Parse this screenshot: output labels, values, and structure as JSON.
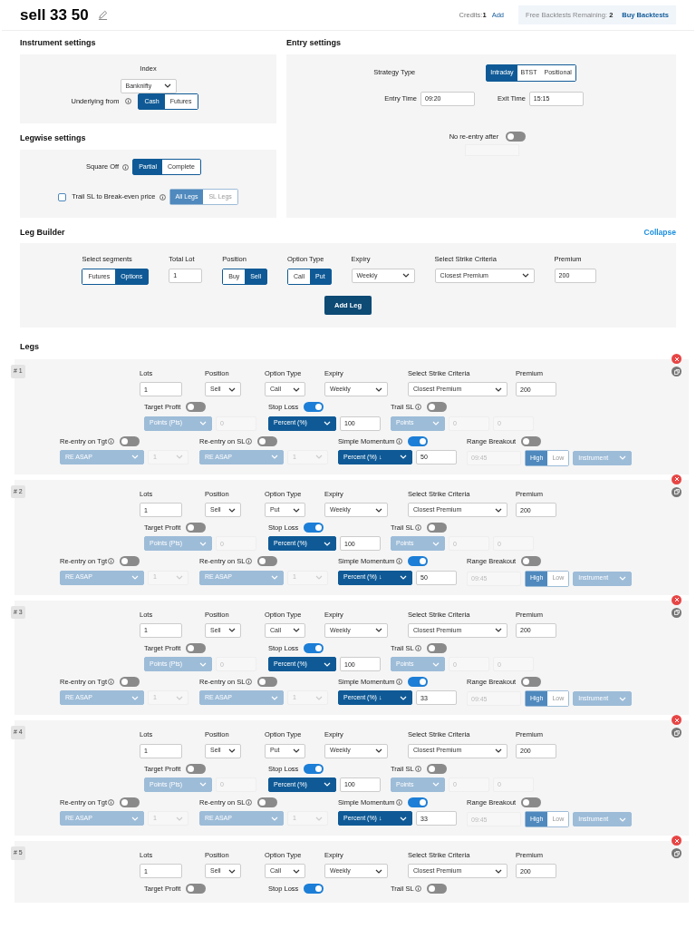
{
  "header": {
    "title": "sell 33 50",
    "credits_label": "Credits:",
    "credits_value": "1",
    "add_link": "Add",
    "backtests_label": "Free Backtests Remaining:",
    "backtests_value": "2",
    "buy_link": "Buy Backtests"
  },
  "instrument_settings": {
    "title": "Instrument settings",
    "index_label": "Index",
    "index_value": "Banknifty",
    "underlying_label": "Underlying from",
    "underlying_options": [
      {
        "label": "Cash",
        "selected": true
      },
      {
        "label": "Futures",
        "selected": false
      }
    ]
  },
  "legwise_settings": {
    "title": "Legwise settings",
    "square_off_label": "Square Off",
    "square_off_options": [
      {
        "label": "Partial",
        "selected": true
      },
      {
        "label": "Complete",
        "selected": false
      }
    ],
    "trail_label": "Trail SL to Break-even price",
    "trail_checked": false,
    "trail_options_disabled": true,
    "trail_options": [
      {
        "label": "All Legs",
        "selected": true
      },
      {
        "label": "SL Legs",
        "selected": false
      }
    ]
  },
  "entry_settings": {
    "title": "Entry settings",
    "strategy_label": "Strategy Type",
    "strategy_options": [
      {
        "label": "Intraday",
        "selected": true
      },
      {
        "label": "BTST",
        "selected": false
      },
      {
        "label": "Positional",
        "selected": false
      }
    ],
    "entry_time_label": "Entry Time",
    "entry_time": "09:20",
    "exit_time_label": "Exit Time",
    "exit_time": "15:15",
    "no_reentry_label": "No re-entry after",
    "no_reentry_on": false
  },
  "leg_builder": {
    "title": "Leg Builder",
    "collapse_link": "Collapse",
    "add_button": "Add Leg",
    "fields": [
      {
        "label": "Select segments",
        "kind": "segmented",
        "options": [
          {
            "label": "Futures",
            "selected": false
          },
          {
            "label": "Options",
            "selected": true
          }
        ]
      },
      {
        "label": "Total Lot",
        "kind": "input",
        "value": "1"
      },
      {
        "label": "Position",
        "kind": "segmented",
        "options": [
          {
            "label": "Buy",
            "selected": false
          },
          {
            "label": "Sell",
            "selected": true
          }
        ]
      },
      {
        "label": "Option Type",
        "kind": "segmented",
        "options": [
          {
            "label": "Call",
            "selected": false
          },
          {
            "label": "Put",
            "selected": true
          }
        ]
      },
      {
        "label": "Expiry",
        "kind": "select",
        "value": "Weekly"
      },
      {
        "label": "Select Strike Criteria",
        "kind": "select",
        "value": "Closest Premium"
      },
      {
        "label": "Premium",
        "kind": "input",
        "value": "200"
      }
    ]
  },
  "legs_title": "Legs",
  "legs": [
    {
      "number": "# 1",
      "fields": [
        {
          "label": "Lots",
          "kind": "input",
          "value": "1"
        },
        {
          "label": "Position",
          "kind": "select",
          "value": "Sell"
        },
        {
          "label": "Option Type",
          "kind": "select",
          "value": "Call"
        },
        {
          "label": "Expiry",
          "kind": "select",
          "value": "Weekly"
        },
        {
          "label": "Select Strike Criteria",
          "kind": "select",
          "value": "Closest Premium"
        },
        {
          "label": "Premium",
          "kind": "input",
          "value": "200"
        }
      ],
      "rows": [
        [
          {
            "label": "Target Profit",
            "info": false,
            "on": false,
            "controls": [
              {
                "kind": "select",
                "value": "Points (Pts)",
                "disabled": true
              },
              {
                "kind": "input",
                "value": "0",
                "disabled": true
              }
            ]
          },
          {
            "label": "Stop Loss",
            "info": false,
            "on": true,
            "controls": [
              {
                "kind": "select",
                "value": "Percent (%)",
                "disabled": false
              },
              {
                "kind": "input",
                "value": "100",
                "disabled": false
              }
            ]
          },
          {
            "label": "Trail SL",
            "info": true,
            "on": false,
            "controls": [
              {
                "kind": "select",
                "value": "Points",
                "disabled": true
              },
              {
                "kind": "input",
                "value": "0",
                "disabled": true
              },
              {
                "kind": "input",
                "value": "0",
                "disabled": true
              }
            ]
          }
        ],
        [
          {
            "label": "Re-entry on Tgt",
            "info": true,
            "on": false,
            "controls": [
              {
                "kind": "select",
                "value": "RE ASAP",
                "disabled": true
              },
              {
                "kind": "select",
                "value": "1",
                "disabled": true
              }
            ]
          },
          {
            "label": "Re-entry on SL",
            "info": true,
            "on": false,
            "controls": [
              {
                "kind": "select",
                "value": "RE ASAP",
                "disabled": true
              },
              {
                "kind": "select",
                "value": "1",
                "disabled": true
              }
            ]
          },
          {
            "label": "Simple Momentum",
            "info": true,
            "on": true,
            "controls": [
              {
                "kind": "select",
                "value": "Percent (%) ↓",
                "disabled": false
              },
              {
                "kind": "input",
                "value": "50",
                "disabled": false
              }
            ]
          },
          {
            "label": "Range Breakout",
            "info": false,
            "on": false,
            "controls": [
              {
                "kind": "input",
                "value": "09:45",
                "disabled": true
              },
              {
                "kind": "segmented",
                "disabled": true,
                "options": [
                  {
                    "label": "High",
                    "selected": true
                  },
                  {
                    "label": "Low",
                    "selected": false
                  }
                ]
              },
              {
                "kind": "select",
                "value": "Instrument",
                "disabled": true
              }
            ]
          }
        ]
      ]
    },
    {
      "number": "# 2",
      "fields": [
        {
          "label": "Lots",
          "kind": "input",
          "value": "1"
        },
        {
          "label": "Position",
          "kind": "select",
          "value": "Sell"
        },
        {
          "label": "Option Type",
          "kind": "select",
          "value": "Put"
        },
        {
          "label": "Expiry",
          "kind": "select",
          "value": "Weekly"
        },
        {
          "label": "Select Strike Criteria",
          "kind": "select",
          "value": "Closest Premium"
        },
        {
          "label": "Premium",
          "kind": "input",
          "value": "200"
        }
      ],
      "rows": [
        [
          {
            "label": "Target Profit",
            "info": false,
            "on": false,
            "controls": [
              {
                "kind": "select",
                "value": "Points (Pts)",
                "disabled": true
              },
              {
                "kind": "input",
                "value": "0",
                "disabled": true
              }
            ]
          },
          {
            "label": "Stop Loss",
            "info": false,
            "on": true,
            "controls": [
              {
                "kind": "select",
                "value": "Percent (%)",
                "disabled": false
              },
              {
                "kind": "input",
                "value": "100",
                "disabled": false
              }
            ]
          },
          {
            "label": "Trail SL",
            "info": true,
            "on": false,
            "controls": [
              {
                "kind": "select",
                "value": "Points",
                "disabled": true
              },
              {
                "kind": "input",
                "value": "0",
                "disabled": true
              },
              {
                "kind": "input",
                "value": "0",
                "disabled": true
              }
            ]
          }
        ],
        [
          {
            "label": "Re-entry on Tgt",
            "info": true,
            "on": false,
            "controls": [
              {
                "kind": "select",
                "value": "RE ASAP",
                "disabled": true
              },
              {
                "kind": "select",
                "value": "1",
                "disabled": true
              }
            ]
          },
          {
            "label": "Re-entry on SL",
            "info": true,
            "on": false,
            "controls": [
              {
                "kind": "select",
                "value": "RE ASAP",
                "disabled": true
              },
              {
                "kind": "select",
                "value": "1",
                "disabled": true
              }
            ]
          },
          {
            "label": "Simple Momentum",
            "info": true,
            "on": true,
            "controls": [
              {
                "kind": "select",
                "value": "Percent (%) ↓",
                "disabled": false
              },
              {
                "kind": "input",
                "value": "50",
                "disabled": false
              }
            ]
          },
          {
            "label": "Range Breakout",
            "info": false,
            "on": false,
            "controls": [
              {
                "kind": "input",
                "value": "09:45",
                "disabled": true
              },
              {
                "kind": "segmented",
                "disabled": true,
                "options": [
                  {
                    "label": "High",
                    "selected": true
                  },
                  {
                    "label": "Low",
                    "selected": false
                  }
                ]
              },
              {
                "kind": "select",
                "value": "Instrument",
                "disabled": true
              }
            ]
          }
        ]
      ]
    },
    {
      "number": "# 3",
      "fields": [
        {
          "label": "Lots",
          "kind": "input",
          "value": "1"
        },
        {
          "label": "Position",
          "kind": "select",
          "value": "Sell"
        },
        {
          "label": "Option Type",
          "kind": "select",
          "value": "Call"
        },
        {
          "label": "Expiry",
          "kind": "select",
          "value": "Weekly"
        },
        {
          "label": "Select Strike Criteria",
          "kind": "select",
          "value": "Closest Premium"
        },
        {
          "label": "Premium",
          "kind": "input",
          "value": "200"
        }
      ],
      "rows": [
        [
          {
            "label": "Target Profit",
            "info": false,
            "on": false,
            "controls": [
              {
                "kind": "select",
                "value": "Points (Pts)",
                "disabled": true
              },
              {
                "kind": "input",
                "value": "0",
                "disabled": true
              }
            ]
          },
          {
            "label": "Stop Loss",
            "info": false,
            "on": true,
            "controls": [
              {
                "kind": "select",
                "value": "Percent (%)",
                "disabled": false
              },
              {
                "kind": "input",
                "value": "100",
                "disabled": false
              }
            ]
          },
          {
            "label": "Trail SL",
            "info": true,
            "on": false,
            "controls": [
              {
                "kind": "select",
                "value": "Points",
                "disabled": true
              },
              {
                "kind": "input",
                "value": "0",
                "disabled": true
              },
              {
                "kind": "input",
                "value": "0",
                "disabled": true
              }
            ]
          }
        ],
        [
          {
            "label": "Re-entry on Tgt",
            "info": true,
            "on": false,
            "controls": [
              {
                "kind": "select",
                "value": "RE ASAP",
                "disabled": true
              },
              {
                "kind": "select",
                "value": "1",
                "disabled": true
              }
            ]
          },
          {
            "label": "Re-entry on SL",
            "info": true,
            "on": false,
            "controls": [
              {
                "kind": "select",
                "value": "RE ASAP",
                "disabled": true
              },
              {
                "kind": "select",
                "value": "1",
                "disabled": true
              }
            ]
          },
          {
            "label": "Simple Momentum",
            "info": true,
            "on": true,
            "controls": [
              {
                "kind": "select",
                "value": "Percent (%) ↓",
                "disabled": false
              },
              {
                "kind": "input",
                "value": "33",
                "disabled": false
              }
            ]
          },
          {
            "label": "Range Breakout",
            "info": false,
            "on": false,
            "controls": [
              {
                "kind": "input",
                "value": "09:45",
                "disabled": true
              },
              {
                "kind": "segmented",
                "disabled": true,
                "options": [
                  {
                    "label": "High",
                    "selected": true
                  },
                  {
                    "label": "Low",
                    "selected": false
                  }
                ]
              },
              {
                "kind": "select",
                "value": "Instrument",
                "disabled": true
              }
            ]
          }
        ]
      ]
    },
    {
      "number": "# 4",
      "fields": [
        {
          "label": "Lots",
          "kind": "input",
          "value": "1"
        },
        {
          "label": "Position",
          "kind": "select",
          "value": "Sell"
        },
        {
          "label": "Option Type",
          "kind": "select",
          "value": "Put"
        },
        {
          "label": "Expiry",
          "kind": "select",
          "value": "Weekly"
        },
        {
          "label": "Select Strike Criteria",
          "kind": "select",
          "value": "Closest Premium"
        },
        {
          "label": "Premium",
          "kind": "input",
          "value": "200"
        }
      ],
      "rows": [
        [
          {
            "label": "Target Profit",
            "info": false,
            "on": false,
            "controls": [
              {
                "kind": "select",
                "value": "Points (Pts)",
                "disabled": true
              },
              {
                "kind": "input",
                "value": "0",
                "disabled": true
              }
            ]
          },
          {
            "label": "Stop Loss",
            "info": false,
            "on": true,
            "controls": [
              {
                "kind": "select",
                "value": "Percent (%)",
                "disabled": false
              },
              {
                "kind": "input",
                "value": "100",
                "disabled": false
              }
            ]
          },
          {
            "label": "Trail SL",
            "info": true,
            "on": false,
            "controls": [
              {
                "kind": "select",
                "value": "Points",
                "disabled": true
              },
              {
                "kind": "input",
                "value": "0",
                "disabled": true
              },
              {
                "kind": "input",
                "value": "0",
                "disabled": true
              }
            ]
          }
        ],
        [
          {
            "label": "Re-entry on Tgt",
            "info": true,
            "on": false,
            "controls": [
              {
                "kind": "select",
                "value": "RE ASAP",
                "disabled": true
              },
              {
                "kind": "select",
                "value": "1",
                "disabled": true
              }
            ]
          },
          {
            "label": "Re-entry on SL",
            "info": true,
            "on": false,
            "controls": [
              {
                "kind": "select",
                "value": "RE ASAP",
                "disabled": true
              },
              {
                "kind": "select",
                "value": "1",
                "disabled": true
              }
            ]
          },
          {
            "label": "Simple Momentum",
            "info": true,
            "on": true,
            "controls": [
              {
                "kind": "select",
                "value": "Percent (%) ↓",
                "disabled": false
              },
              {
                "kind": "input",
                "value": "33",
                "disabled": false
              }
            ]
          },
          {
            "label": "Range Breakout",
            "info": false,
            "on": false,
            "controls": [
              {
                "kind": "input",
                "value": "09:45",
                "disabled": true
              },
              {
                "kind": "segmented",
                "disabled": true,
                "options": [
                  {
                    "label": "High",
                    "selected": true
                  },
                  {
                    "label": "Low",
                    "selected": false
                  }
                ]
              },
              {
                "kind": "select",
                "value": "Instrument",
                "disabled": true
              }
            ]
          }
        ]
      ]
    },
    {
      "number": "# 5",
      "fields": [
        {
          "label": "Lots",
          "kind": "input",
          "value": "1"
        },
        {
          "label": "Position",
          "kind": "select",
          "value": "Sell"
        },
        {
          "label": "Option Type",
          "kind": "select",
          "value": "Call"
        },
        {
          "label": "Expiry",
          "kind": "select",
          "value": "Weekly"
        },
        {
          "label": "Select Strike Criteria",
          "kind": "select",
          "value": "Closest Premium"
        },
        {
          "label": "Premium",
          "kind": "input",
          "value": "200"
        }
      ],
      "rows": [
        [
          {
            "label": "Target Profit",
            "info": false,
            "on": false
          },
          {
            "label": "Stop Loss",
            "info": false,
            "on": true
          },
          {
            "label": "Trail SL",
            "info": true,
            "on": false
          }
        ]
      ]
    }
  ]
}
